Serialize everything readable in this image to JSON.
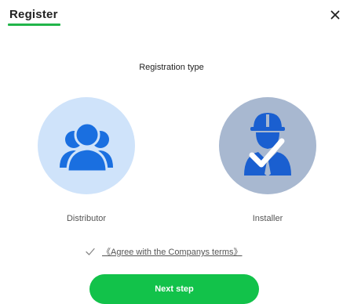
{
  "dialog": {
    "title": "Register",
    "close_icon": "close-icon",
    "subtitle": "Registration type",
    "accent_color": "#21b54a"
  },
  "types": [
    {
      "label": "Distributor",
      "icon": "users-group-icon",
      "color": "#1a6fe0",
      "selected": false
    },
    {
      "label": "Installer",
      "icon": "installer-worker-icon",
      "color": "#1a5fd0",
      "selected": true
    }
  ],
  "agreement": {
    "checked": true,
    "link_text": "《Agree with the Companys terms》"
  },
  "actions": {
    "next_label": "Next step",
    "button_color": "#12c24a"
  }
}
